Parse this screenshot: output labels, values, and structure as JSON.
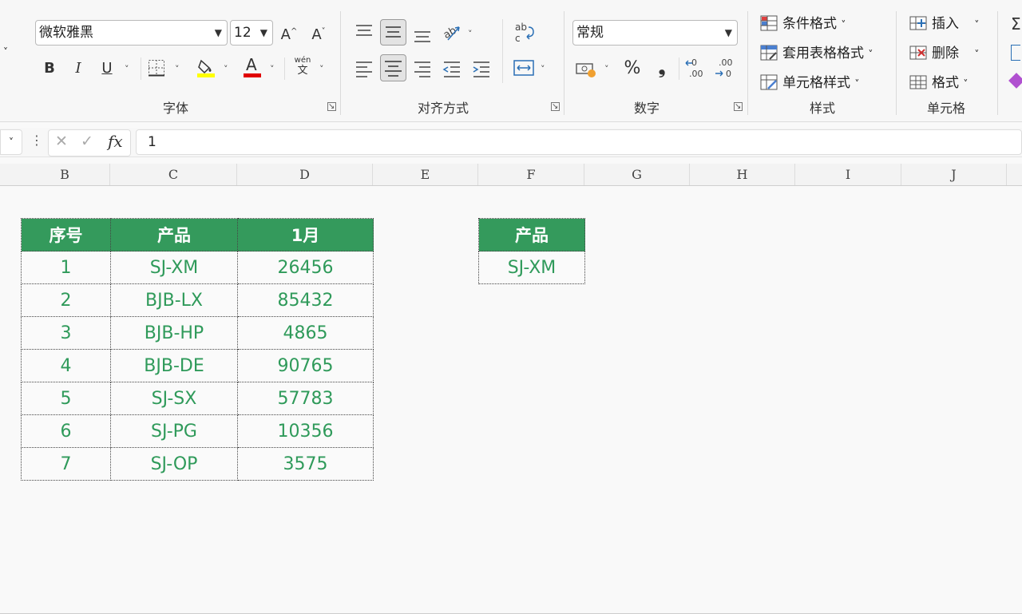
{
  "ribbon": {
    "font": {
      "name": "微软雅黑",
      "size": "12",
      "grow_icon": "A^",
      "shrink_icon": "A˅",
      "bold": "B",
      "italic": "I",
      "underline": "U",
      "phonetic_top": "wén",
      "phonetic_bottom": "文",
      "group_label": "字体"
    },
    "alignment": {
      "group_label": "对齐方式"
    },
    "number": {
      "format": "常规",
      "percent": "%",
      "comma": "❟",
      "group_label": "数字"
    },
    "styles": {
      "conditional": "条件格式",
      "table_format": "套用表格格式",
      "cell_style": "单元格样式",
      "group_label": "样式"
    },
    "cells": {
      "insert": "插入",
      "delete": "删除",
      "format": "格式",
      "group_label": "单元格"
    },
    "colors": {
      "fill": "#ffff00",
      "font": "#e00000",
      "accent": "#2e7d5a"
    }
  },
  "formula_bar": {
    "cancel": "✕",
    "enter": "✓",
    "fx": "fx",
    "value": "1"
  },
  "columns": [
    "B",
    "C",
    "D",
    "E",
    "F",
    "G",
    "H",
    "I",
    "J"
  ],
  "main_table": {
    "headers": [
      "序号",
      "产品",
      "1月"
    ],
    "rows": [
      [
        "1",
        "SJ-XM",
        "26456"
      ],
      [
        "2",
        "BJB-LX",
        "85432"
      ],
      [
        "3",
        "BJB-HP",
        "4865"
      ],
      [
        "4",
        "BJB-DE",
        "90765"
      ],
      [
        "5",
        "SJ-SX",
        "57783"
      ],
      [
        "6",
        "SJ-PG",
        "10356"
      ],
      [
        "7",
        "SJ-OP",
        "3575"
      ]
    ]
  },
  "lookup_table": {
    "header": "产品",
    "value": "SJ-XM"
  },
  "theme": {
    "header_bg": "#349a5c",
    "cell_text": "#2f9a5a"
  }
}
